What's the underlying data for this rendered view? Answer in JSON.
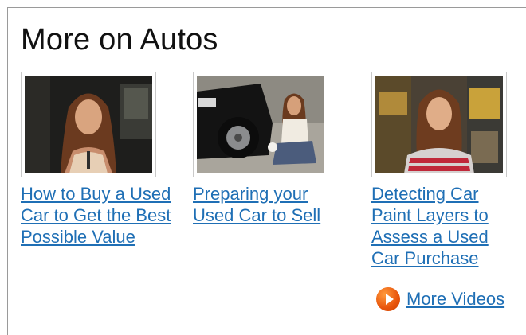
{
  "section": {
    "title": "More on Autos"
  },
  "videos": [
    {
      "caption": "How to Buy a Used Car to Get the Best Possible Value",
      "thumb_icon": "woman-presenter-thumbnail"
    },
    {
      "caption": "Preparing your Used Car to Sell",
      "thumb_icon": "woman-kneeling-by-car-wheel-thumbnail"
    },
    {
      "caption": "Detecting Car Paint Layers to Assess a Used Car Purchase",
      "thumb_icon": "woman-in-garage-thumbnail"
    }
  ],
  "more_videos": {
    "label": "More Videos",
    "icon": "play-circle-icon"
  },
  "colors": {
    "link": "#1f6fb5",
    "play_button": "#e8540b",
    "border": "#9a9a9a"
  }
}
